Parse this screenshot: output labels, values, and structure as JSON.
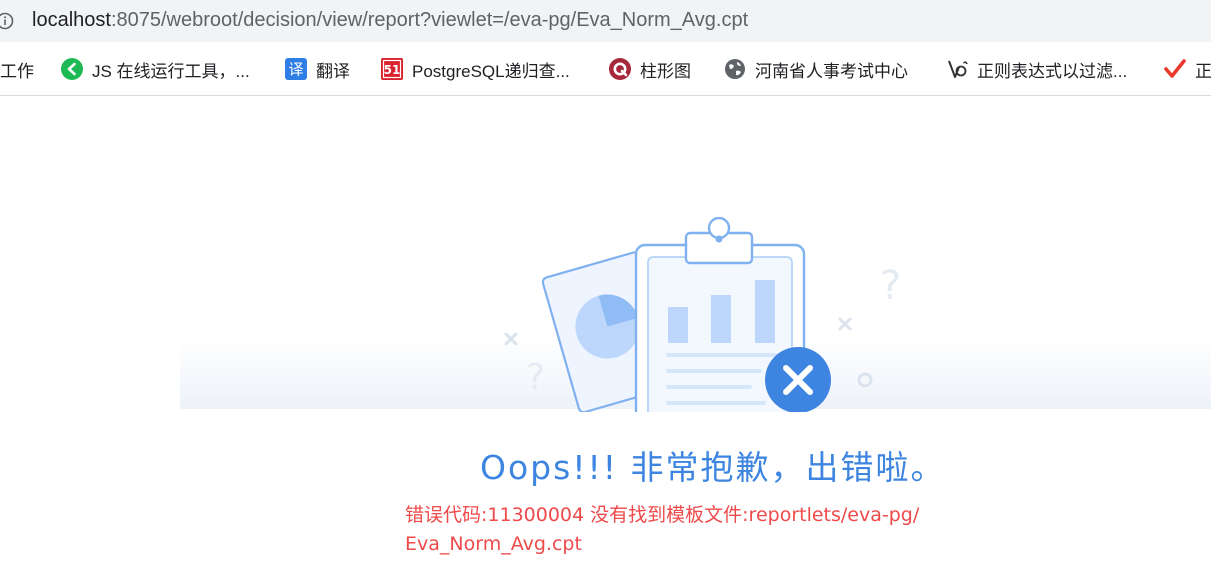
{
  "browser": {
    "url_host": "localhost",
    "url_rest": ":8075/webroot/decision/view/report?viewlet=/eva-pg/Eva_Norm_Avg.cpt",
    "info_icon": "info-icon"
  },
  "bookmarks": [
    {
      "label": "工作",
      "icon": "none"
    },
    {
      "label": "JS 在线运行工具，...",
      "icon": "green-k-icon",
      "color": "#1db954"
    },
    {
      "label": "翻译",
      "icon": "translate-icon",
      "color": "#2f7ee6"
    },
    {
      "label": "PostgreSQL递归查...",
      "icon": "51-icon",
      "color": "#d9232d"
    },
    {
      "label": "柱形图",
      "icon": "q-logo-icon",
      "color": "#a5283b"
    },
    {
      "label": "河南省人事考试中心",
      "icon": "globe-icon",
      "color": "#5f6368"
    },
    {
      "label": "正则表达式以过滤...",
      "icon": "regex-icon",
      "color": "#333333"
    },
    {
      "label": "正",
      "icon": "checkmark-icon",
      "color": "#e8392c"
    }
  ],
  "error_page": {
    "headline": "Oops!!! 非常抱歉，出错啦。",
    "message": "错误代码:11300004 没有找到模板文件:reportlets/eva-pg/Eva_Norm_Avg.cpt",
    "headline_color": "#3d85e0",
    "message_color": "#ef4a4a"
  }
}
